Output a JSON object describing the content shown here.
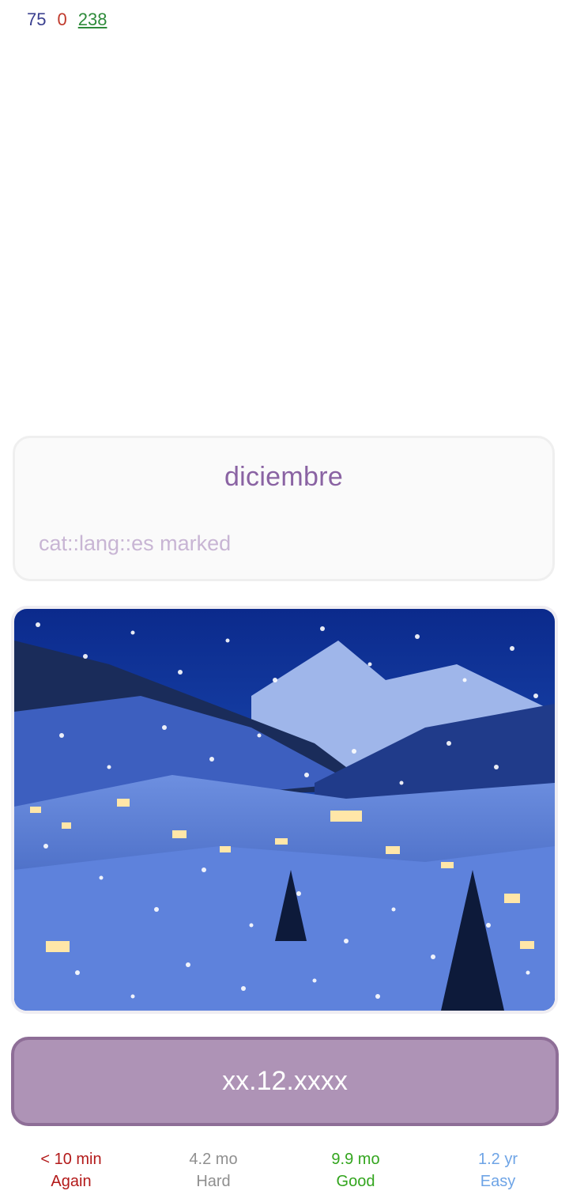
{
  "counts": {
    "new": "75",
    "learning": "0",
    "review": "238"
  },
  "card": {
    "word": "diciembre",
    "tags": "cat::lang::es marked"
  },
  "image": {
    "subject": "snowy mountain village at night"
  },
  "answer": {
    "text": "xx.12.xxxx"
  },
  "ease_buttons": [
    {
      "time": "< 10 min",
      "label": "Again",
      "color": "#b31a1a"
    },
    {
      "time": "4.2 mo",
      "label": "Hard",
      "color": "#8f8f8f"
    },
    {
      "time": "9.9 mo",
      "label": "Good",
      "color": "#33a51e"
    },
    {
      "time": "1.2 yr",
      "label": "Easy",
      "color": "#6ea4e6"
    }
  ]
}
